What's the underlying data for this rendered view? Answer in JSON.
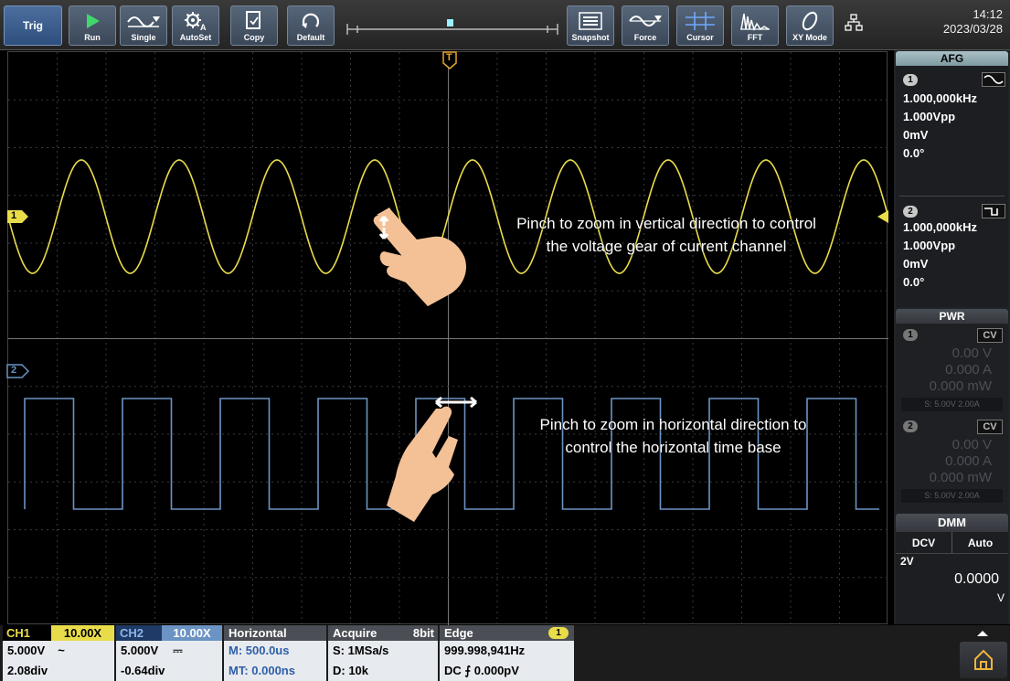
{
  "toolbar": {
    "trig_label": "Trig",
    "buttons": [
      "Run",
      "Single",
      "AutoSet",
      "Copy",
      "Default",
      "Snapshot",
      "Force",
      "Cursor",
      "FFT",
      "XY Mode"
    ],
    "time": "14:12",
    "date": "2023/03/28",
    "colors": {
      "run": "#3fd86b",
      "accent": "#4a6d9f"
    }
  },
  "screen": {
    "trigger_marker": "T",
    "ch1_marker": "1",
    "ch2_marker": "2",
    "ch1_color": "#e8dc4a",
    "ch2_color": "#6b93c4",
    "hint_vertical": [
      "Pinch to zoom in vertical direction to control",
      "the voltage gear of current channel"
    ],
    "hint_horizontal": [
      "Pinch to zoom in horizontal direction to",
      "control the horizontal time base"
    ]
  },
  "afg": {
    "title": "AFG",
    "ch1": {
      "num": "1",
      "freq": "1.000,000kHz",
      "amp": "1.000Vpp",
      "offset": "0mV",
      "phase": "0.0°",
      "wave_icon": "sine-wave-icon"
    },
    "ch2": {
      "num": "2",
      "freq": "1.000,000kHz",
      "amp": "1.000Vpp",
      "offset": "0mV",
      "phase": "0.0°",
      "wave_icon": "square-wave-icon"
    }
  },
  "pwr": {
    "title": "PWR",
    "ch1": {
      "num": "1",
      "mode": "CV",
      "voltage": "0.00 V",
      "current": "0.000 A",
      "power": "0.000 mW",
      "setting": "S: 5.00V 2.00A"
    },
    "ch2": {
      "num": "2",
      "mode": "CV",
      "voltage": "0.00 V",
      "current": "0.000 A",
      "power": "0.000 mW",
      "setting": "S: 5.00V 2.00A"
    }
  },
  "dmm": {
    "title": "DMM",
    "mode": "DCV",
    "range_mode": "Auto",
    "range": "2V",
    "value": "0.0000",
    "unit": "V"
  },
  "bottom": {
    "ch1": {
      "label": "CH1",
      "probe": "10.00X",
      "scale": "5.000V",
      "coupling": "~",
      "offset": "2.08div"
    },
    "ch2": {
      "label": "CH2",
      "probe": "10.00X",
      "scale": "5.000V",
      "coupling": "⎓",
      "offset": "-0.64div"
    },
    "horizontal": {
      "label": "Horizontal",
      "main": "M: 500.0us",
      "main_trig": "MT: 0.000ns"
    },
    "acquire": {
      "label": "Acquire",
      "bits": "8bit",
      "rate": "S: 1MSa/s",
      "depth": "D: 10k"
    },
    "trigger": {
      "label": "Edge",
      "source": "1",
      "freq": "999.998,941Hz",
      "level": "DC ⨍ 0.000pV"
    }
  }
}
